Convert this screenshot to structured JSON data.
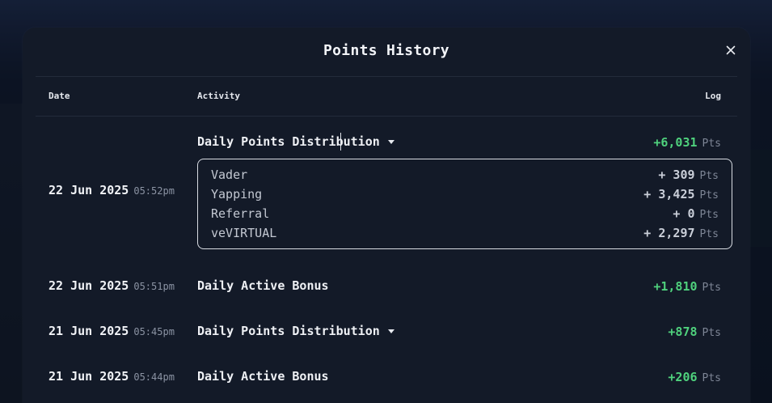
{
  "modal": {
    "title": "Points History",
    "close_icon": "close-icon"
  },
  "columns": {
    "date": "Date",
    "activity": "Activity",
    "log": "Log"
  },
  "unit": "Pts",
  "rows": [
    {
      "date": "22 Jun 2025",
      "time": "05:52pm",
      "activity": "Daily Points Distribution",
      "expandable": true,
      "expanded": true,
      "log": "+6,031",
      "breakdown": [
        {
          "name": "Vader",
          "value": "+ 309"
        },
        {
          "name": "Yapping",
          "value": "+ 3,425"
        },
        {
          "name": "Referral",
          "value": "+ 0"
        },
        {
          "name": "veVIRTUAL",
          "value": "+ 2,297"
        }
      ]
    },
    {
      "date": "22 Jun 2025",
      "time": "05:51pm",
      "activity": "Daily Active Bonus",
      "expandable": false,
      "log": "+1,810"
    },
    {
      "date": "21 Jun 2025",
      "time": "05:45pm",
      "activity": "Daily Points Distribution",
      "expandable": true,
      "expanded": false,
      "log": "+878"
    },
    {
      "date": "21 Jun 2025",
      "time": "05:44pm",
      "activity": "Daily Active Bonus",
      "expandable": false,
      "log": "+206"
    }
  ],
  "colors": {
    "positive": "#4fd17d",
    "modal_bg": "#131a28",
    "muted": "#7d8595"
  }
}
